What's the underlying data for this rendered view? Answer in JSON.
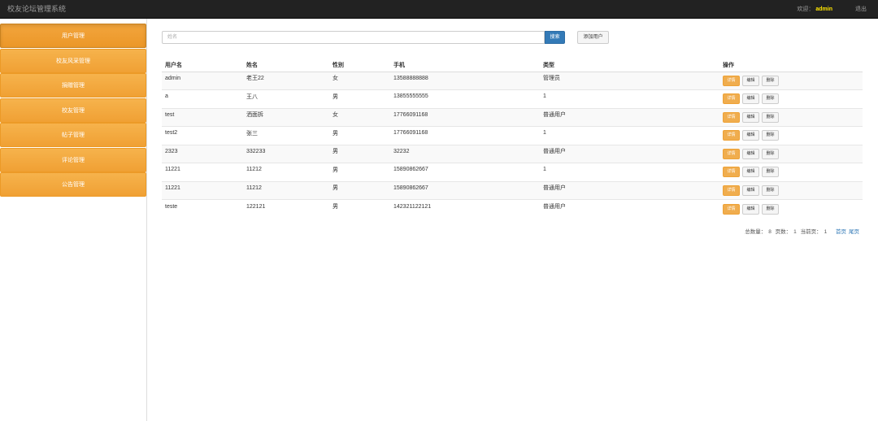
{
  "app": {
    "title": "校友论坛管理系统",
    "welcome_label": "欢迎：",
    "user": "admin",
    "logout": "退出"
  },
  "sidebar": {
    "items": [
      {
        "label": "用户管理",
        "active": true
      },
      {
        "label": "校友风采管理",
        "active": false
      },
      {
        "label": "捐赠管理",
        "active": false
      },
      {
        "label": "校友管理",
        "active": false
      },
      {
        "label": "帖子管理",
        "active": false
      },
      {
        "label": "评论管理",
        "active": false
      },
      {
        "label": "公告管理",
        "active": false
      }
    ]
  },
  "search": {
    "placeholder": "姓名",
    "value": "",
    "button": "搜索",
    "add_button": "添加用户"
  },
  "table": {
    "headers": [
      "用户名",
      "姓名",
      "性别",
      "手机",
      "类型",
      "操作"
    ],
    "actions": {
      "detail": "详情",
      "edit": "编辑",
      "delete": "删除"
    },
    "rows": [
      [
        "admin",
        "老王22",
        "女",
        "13588888888",
        "管理员"
      ],
      [
        "a",
        "王八",
        "男",
        "13855555555",
        "1"
      ],
      [
        "test",
        "洒面拆",
        "女",
        "17766091168",
        "普通用户"
      ],
      [
        "test2",
        "张三",
        "男",
        "17766091168",
        "1"
      ],
      [
        "2323",
        "332233",
        "男",
        "32232",
        "普通用户"
      ],
      [
        "11221",
        "11212",
        "男",
        "15890862667",
        "1"
      ],
      [
        "11221",
        "11212",
        "男",
        "15890862667",
        "普通用户"
      ],
      [
        "teste",
        "122121",
        "男",
        "142321122121",
        "普通用户"
      ]
    ]
  },
  "pager": {
    "total_label": "总数量：",
    "total": "8",
    "pages_label": "页数：",
    "pages": "1",
    "current_label": "当前页：",
    "current": "1",
    "first": "首页",
    "last": "尾页"
  },
  "colors": {
    "topbar": "#222222",
    "sidebar_button": "#f0a034",
    "primary": "#337ab7",
    "warning": "#f0ad4e",
    "welcome_user": "#ffe500"
  }
}
